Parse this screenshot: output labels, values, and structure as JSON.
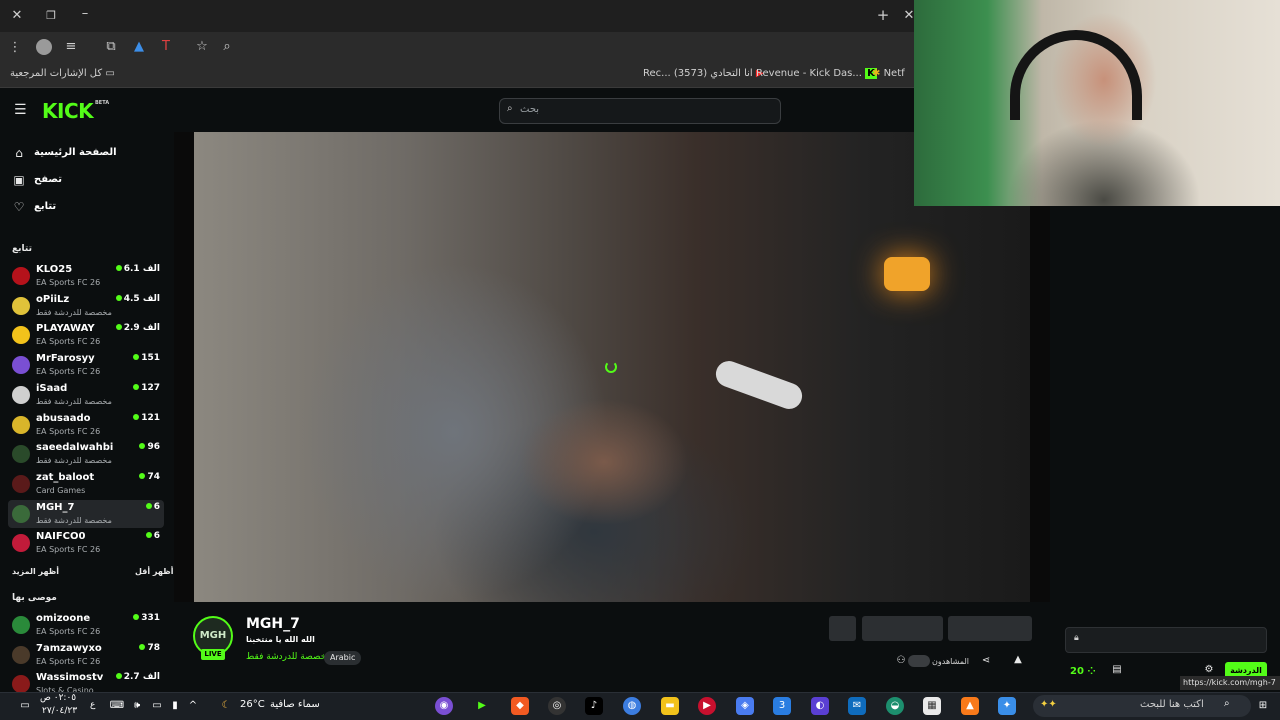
{
  "browser": {
    "bookmarks_all_label": "كل الإشارات المرجعية",
    "bookmarks": [
      {
        "label": "Rec... (3573) انا التحادي"
      },
      {
        "label": "Revenue - Kick Das..."
      },
      {
        "label": "Netf"
      }
    ]
  },
  "header": {
    "logo": "KICK",
    "logo_badge": "BETA",
    "search_placeholder": "بحث"
  },
  "sidebar": {
    "nav": [
      {
        "label": "الصفحة الرئيسية",
        "icon": "home-icon"
      },
      {
        "label": "تصفح",
        "icon": "browse-icon"
      },
      {
        "label": "تتابع",
        "icon": "heart-icon"
      }
    ],
    "following_title": "تتابع",
    "following": [
      {
        "name": "KLO25",
        "category": "EA Sports FC 26",
        "viewers": "6.1 الف",
        "avatar_color": "#b5121b"
      },
      {
        "name": "oPiiLz",
        "category": "مخصصة للدردشة فقط",
        "viewers": "4.5 الف",
        "avatar_color": "#e0c23a"
      },
      {
        "name": "PLAYAWAY",
        "category": "EA Sports FC 26",
        "viewers": "2.9 الف",
        "avatar_color": "#f2c21b"
      },
      {
        "name": "MrFarosyy",
        "category": "EA Sports FC 26",
        "viewers": "151",
        "avatar_color": "#7a4fd3"
      },
      {
        "name": "iSaad",
        "category": "مخصصة للدردشة فقط",
        "viewers": "127",
        "avatar_color": "#cfcfcf"
      },
      {
        "name": "abusaado",
        "category": "EA Sports FC 26",
        "viewers": "121",
        "avatar_color": "#d9b52a"
      },
      {
        "name": "saeedalwahbi",
        "category": "مخصصة للدردشة فقط",
        "viewers": "96",
        "avatar_color": "#2a4a2a"
      },
      {
        "name": "zat_baloot",
        "category": "Card Games",
        "viewers": "74",
        "avatar_color": "#5a1a1a"
      },
      {
        "name": "MGH_7",
        "category": "مخصصة للدردشة فقط",
        "viewers": "6",
        "avatar_color": "#3a6a3a"
      },
      {
        "name": "NAIFCO0",
        "category": "EA Sports FC 26",
        "viewers": "6",
        "avatar_color": "#c21b3a"
      }
    ],
    "show_less": "أظهر أقل",
    "show_more": "أظهر المزيد",
    "recommended_title": "موصى بها",
    "recommended": [
      {
        "name": "omizoone",
        "category": "EA Sports FC 26",
        "viewers": "331",
        "avatar_color": "#2a8a3a"
      },
      {
        "name": "7amzawyxo",
        "category": "EA Sports FC 26",
        "viewers": "78",
        "avatar_color": "#4a3a2a"
      },
      {
        "name": "Wassimostv",
        "category": "Slots & Casino",
        "viewers": "2.7 الف",
        "avatar_color": "#8a1a1a"
      }
    ]
  },
  "stream": {
    "channel_name": "MGH_7",
    "avatar_text": "MGH",
    "live_label": "LIVE",
    "title": "الله الله يا منتخبنا",
    "category": "مخصصة للدردشة فقط",
    "language": "Arabic",
    "viewers_label": "المشاهدون"
  },
  "chat": {
    "points": "20",
    "send_label": "الدردشة",
    "url_tooltip": "https://kick.com/mgh-7"
  },
  "taskbar": {
    "search_placeholder": "اكتب هنا للبحث",
    "weather_temp": "26°C",
    "weather_desc": "سماء صافية",
    "time": "٠٢:٠٥ ص",
    "date": "٢٧/٠٤/٢٣",
    "lang": "ع"
  }
}
